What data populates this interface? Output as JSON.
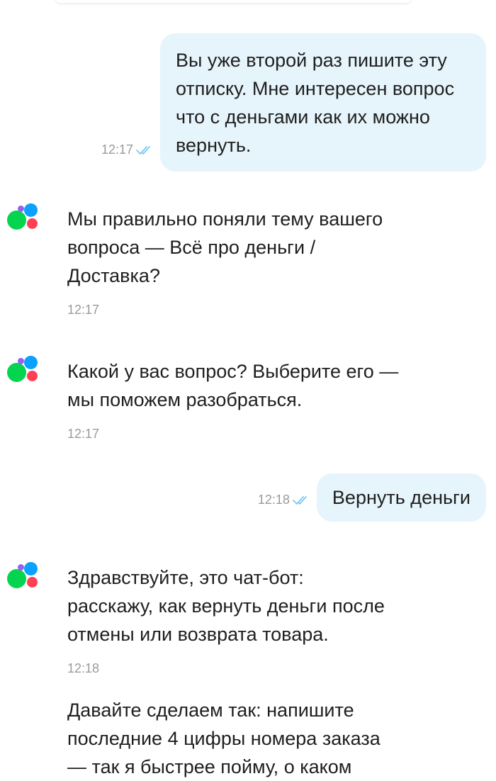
{
  "colors": {
    "outgoing_bubble": "#e6f4fb",
    "read_check": "#7cc8f4",
    "timestamp": "#9a9a9a",
    "avatar_green": "#04d44e",
    "avatar_blue": "#0aa1ff",
    "avatar_purple": "#9a5ff0",
    "avatar_red": "#ff4053"
  },
  "messages": [
    {
      "direction": "outgoing",
      "lines": [
        "Вы уже второй раз пишите эту",
        "отписку. Мне интересен вопрос",
        "что с деньгами как их можно",
        "вернуть."
      ],
      "time": "12:17",
      "status_icon": "double-check-icon"
    },
    {
      "direction": "incoming",
      "lines": [
        "Мы правильно поняли тему вашего",
        "вопроса — Всё про деньги /",
        "Доставка?"
      ],
      "time": "12:17",
      "avatar_icon": "bot-avatar-icon"
    },
    {
      "direction": "incoming",
      "lines": [
        "Какой у вас вопрос? Выберите его —",
        "мы поможем разобраться."
      ],
      "time": "12:17",
      "avatar_icon": "bot-avatar-icon"
    },
    {
      "direction": "outgoing",
      "lines": [
        "Вернуть деньги"
      ],
      "time": "12:18",
      "status_icon": "double-check-icon"
    },
    {
      "direction": "incoming",
      "lines": [
        "Здравствуйте, это чат-бот:",
        "расскажу, как вернуть деньги после",
        "отмены или возврата товара."
      ],
      "time": "12:18",
      "avatar_icon": "bot-avatar-icon"
    },
    {
      "direction": "incoming",
      "lines": [
        "Давайте сделаем так: напишите",
        "последние 4 цифры номера заказа",
        "— так я быстрее пойму, о каком"
      ],
      "time": "",
      "avatar_icon": ""
    }
  ]
}
